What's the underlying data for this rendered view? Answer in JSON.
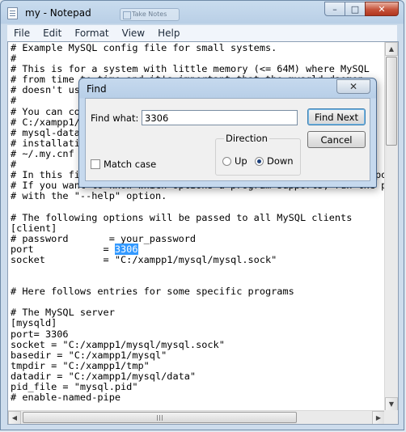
{
  "window": {
    "title": "my - Notepad",
    "ghost_tab_label": "Take Notes",
    "buttons": {
      "minimize": "–",
      "maximize": "□",
      "close": "✕"
    }
  },
  "menu": [
    "File",
    "Edit",
    "Format",
    "View",
    "Help"
  ],
  "editor": {
    "lines": [
      "# Example MySQL config file for small systems.",
      "#",
      "# This is for a system with little memory (<= 64M) where MySQL",
      "# from time to time and it's important that the mysqld daemon",
      "# doesn't use much resources.",
      "#",
      "# You can copy this file to",
      "# C:/xampp1/mysql/bin/my.cnf to set global options,",
      "# mysql-data-dir/my.cnf to set server-specific options (in this",
      "# installation this directory is C:/xampp1/mysql/data) or",
      "# ~/.my.cnf to set user-specific options.",
      "#",
      "# In this file, you can use all long options that a program supports.",
      "# If you want to know which options a program supports, run the program",
      "# with the \"--help\" option.",
      "",
      "# The following options will be passed to all MySQL clients",
      "[client]",
      "# password       = your_password",
      "port            = ",
      "socket          = \"C:/xampp1/mysql/mysql.sock\"",
      "",
      "",
      "# Here follows entries for some specific programs",
      "",
      "# The MySQL server",
      "[mysqld]",
      "port= 3306",
      "socket = \"C:/xampp1/mysql/mysql.sock\"",
      "basedir = \"C:/xampp1/mysql\"",
      "tmpdir = \"C:/xampp1/tmp\"",
      "datadir = \"C:/xampp1/mysql/data\"",
      "pid_file = \"mysql.pid\"",
      "# enable-named-pipe"
    ],
    "selected_text": "3306",
    "selected_line_index": 19
  },
  "find_dialog": {
    "title": "Find",
    "close_label": "✕",
    "find_what_label": "Find what:",
    "find_what_value": "3306",
    "find_next_label": "Find Next",
    "cancel_label": "Cancel",
    "direction_label": "Direction",
    "up_label": "Up",
    "down_label": "Down",
    "direction_selected": "Down",
    "match_case_label": "Match case",
    "match_case_checked": false
  },
  "colors": {
    "selection": "#3399ff",
    "titlebar": "#b9cfe6",
    "close_button": "#c6533a"
  }
}
